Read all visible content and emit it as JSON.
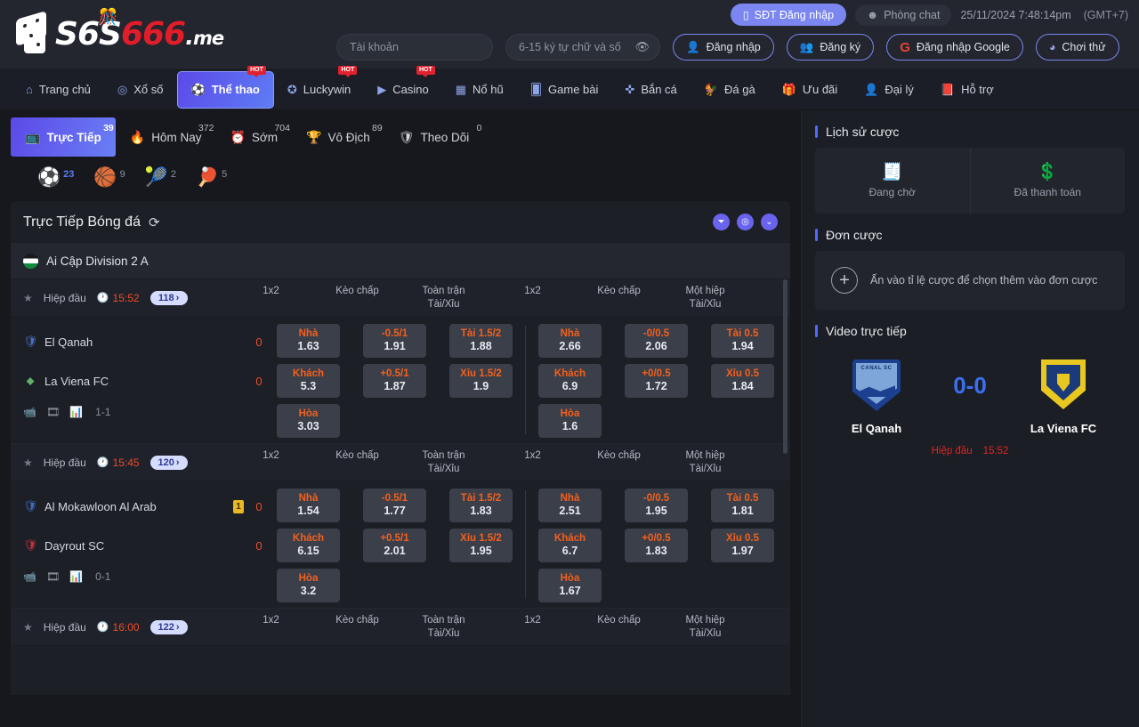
{
  "header": {
    "logo": {
      "s1": "S",
      "six": "6",
      "s2": "S",
      "num": "666",
      "dot": ".",
      "me": "me"
    },
    "phone_login": "SĐT Đăng nhập",
    "chat_room": "Phòng chat",
    "datetime": "25/11/2024 7:48:14pm",
    "gmt": "(GMT+7)",
    "username_placeholder": "Tài khoản",
    "username_value": "",
    "password_placeholder": "6-15 ký tự chữ và số",
    "password_value": "",
    "login": "Đăng nhập",
    "register": "Đăng ký",
    "google_login": "Đăng nhập Google",
    "trial": "Chơi thử"
  },
  "nav": {
    "items": [
      {
        "label": "Trang chủ",
        "icon": "home-icon",
        "hot": false,
        "active": false
      },
      {
        "label": "Xổ số",
        "icon": "lottery-icon",
        "hot": false,
        "active": false
      },
      {
        "label": "Thể thao",
        "icon": "sports-icon",
        "hot": true,
        "active": true
      },
      {
        "label": "Luckywin",
        "icon": "luckywin-icon",
        "hot": true,
        "active": false
      },
      {
        "label": "Casino",
        "icon": "casino-icon",
        "hot": true,
        "active": false
      },
      {
        "label": "Nổ hũ",
        "icon": "slots-icon",
        "hot": false,
        "active": false
      },
      {
        "label": "Game bài",
        "icon": "cards-icon",
        "hot": false,
        "active": false
      },
      {
        "label": "Bắn cá",
        "icon": "fishing-icon",
        "hot": false,
        "active": false
      },
      {
        "label": "Đá gà",
        "icon": "cockfight-icon",
        "hot": false,
        "active": false
      },
      {
        "label": "Ưu đãi",
        "icon": "promo-icon",
        "hot": false,
        "active": false
      },
      {
        "label": "Đại lý",
        "icon": "agent-icon",
        "hot": false,
        "active": false
      },
      {
        "label": "Hỗ trợ",
        "icon": "support-icon",
        "hot": false,
        "active": false
      }
    ]
  },
  "tabs": [
    {
      "label": "Trực Tiếp",
      "count": "39",
      "icon": "live-icon",
      "active": true
    },
    {
      "label": "Hôm Nay",
      "count": "372",
      "icon": "today-icon",
      "active": false
    },
    {
      "label": "Sớm",
      "count": "704",
      "icon": "early-icon",
      "active": false
    },
    {
      "label": "Vô Địch",
      "count": "89",
      "icon": "trophy-icon",
      "active": false
    },
    {
      "label": "Theo Dõi",
      "count": "0",
      "icon": "follow-icon",
      "active": false
    }
  ],
  "sports": [
    {
      "icon": "soccer-ball-icon",
      "glyph": "⚽",
      "count": "23",
      "active": true
    },
    {
      "icon": "basketball-icon",
      "glyph": "🏀",
      "count": "9",
      "active": false
    },
    {
      "icon": "tennis-ball-icon",
      "glyph": "🎾",
      "count": "2",
      "active": false
    },
    {
      "icon": "table-tennis-icon",
      "glyph": "🏓",
      "count": "5",
      "active": false
    }
  ],
  "panel": {
    "title": "Trực Tiếp Bóng đá",
    "refresh_icon": "refresh-icon",
    "head_icons": [
      "filter-icon",
      "settings-icon",
      "collapse-icon"
    ],
    "league": "Ai Cập Division 2 A",
    "column_groups": [
      {
        "title": "",
        "sub": "1x2"
      },
      {
        "title": "",
        "sub": "Kèo chấp"
      },
      {
        "title": "Toàn trận",
        "sub": "Tài/Xỉu"
      },
      {
        "title": "",
        "sub": "1x2"
      },
      {
        "title": "",
        "sub": "Kèo chấp"
      },
      {
        "title": "Một hiệp",
        "sub": "Tài/Xỉu"
      }
    ]
  },
  "matches": [
    {
      "phase": "Hiệp đầu",
      "time": "15:52",
      "badge": "118",
      "home": {
        "name": "El Qanah",
        "score": "0",
        "card": "",
        "icon": "shield-blue-icon"
      },
      "away": {
        "name": "La Viena FC",
        "score": "0",
        "card": "",
        "icon": "shield-green-icon"
      },
      "halftime": "1-1",
      "odds": [
        [
          {
            "lbl": "Nhà",
            "val": "1.63"
          },
          {
            "lbl": "Khách",
            "val": "5.3"
          },
          {
            "lbl": "Hòa",
            "val": "3.03"
          }
        ],
        [
          {
            "lbl": "-0.5/1",
            "val": "1.91"
          },
          {
            "lbl": "+0.5/1",
            "val": "1.87"
          }
        ],
        [
          {
            "lbl": "Tài 1.5/2",
            "val": "1.88"
          },
          {
            "lbl": "Xỉu 1.5/2",
            "val": "1.9"
          }
        ],
        [
          {
            "lbl": "Nhà",
            "val": "2.66"
          },
          {
            "lbl": "Khách",
            "val": "6.9"
          },
          {
            "lbl": "Hòa",
            "val": "1.6"
          }
        ],
        [
          {
            "lbl": "-0/0.5",
            "val": "2.06"
          },
          {
            "lbl": "+0/0.5",
            "val": "1.72"
          }
        ],
        [
          {
            "lbl": "Tài 0.5",
            "val": "1.94"
          },
          {
            "lbl": "Xỉu 0.5",
            "val": "1.84"
          }
        ]
      ]
    },
    {
      "phase": "Hiệp đầu",
      "time": "15:45",
      "badge": "120",
      "home": {
        "name": "Al Mokawloon Al Arab",
        "score": "0",
        "card": "1",
        "icon": "shield-crest-icon"
      },
      "away": {
        "name": "Dayrout SC",
        "score": "0",
        "card": "",
        "icon": "shield-red-icon"
      },
      "halftime": "0-1",
      "odds": [
        [
          {
            "lbl": "Nhà",
            "val": "1.54"
          },
          {
            "lbl": "Khách",
            "val": "6.15"
          },
          {
            "lbl": "Hòa",
            "val": "3.2"
          }
        ],
        [
          {
            "lbl": "-0.5/1",
            "val": "1.77"
          },
          {
            "lbl": "+0.5/1",
            "val": "2.01"
          }
        ],
        [
          {
            "lbl": "Tài 1.5/2",
            "val": "1.83"
          },
          {
            "lbl": "Xỉu 1.5/2",
            "val": "1.95"
          }
        ],
        [
          {
            "lbl": "Nhà",
            "val": "2.51"
          },
          {
            "lbl": "Khách",
            "val": "6.7"
          },
          {
            "lbl": "Hòa",
            "val": "1.67"
          }
        ],
        [
          {
            "lbl": "-0/0.5",
            "val": "1.95"
          },
          {
            "lbl": "+0/0.5",
            "val": "1.83"
          }
        ],
        [
          {
            "lbl": "Tài 0.5",
            "val": "1.81"
          },
          {
            "lbl": "Xỉu 0.5",
            "val": "1.97"
          }
        ]
      ]
    },
    {
      "phase": "Hiệp đầu",
      "time": "16:00",
      "badge": "122",
      "home": {
        "name": "",
        "score": "",
        "card": "",
        "icon": ""
      },
      "away": {
        "name": "",
        "score": "",
        "card": "",
        "icon": ""
      },
      "halftime": "",
      "odds": []
    }
  ],
  "sidebar": {
    "bet_history_title": "Lịch sử cược",
    "bet_history": [
      {
        "label": "Đang chờ",
        "icon": "receipt-icon"
      },
      {
        "label": "Đã thanh toán",
        "icon": "paid-receipt-icon"
      }
    ],
    "bet_slip_title": "Đơn cược",
    "bet_slip_hint": "Ấn vào tỉ lệ cược để chọn thêm vào đơn cược",
    "video_title": "Video trực tiếp",
    "video": {
      "home_team": "El Qanah",
      "away_team": "La Viena FC",
      "score": "0-0",
      "phase": "Hiệp đầu",
      "time": "15:52",
      "home_crest_text": "CANAL SC"
    }
  },
  "colors": {
    "accent_purple": "#6a63ee",
    "accent_blue": "#4f6bff",
    "odds_orange": "#f4601c",
    "live_red": "#ef4b27",
    "hot_red": "#e0212e"
  }
}
